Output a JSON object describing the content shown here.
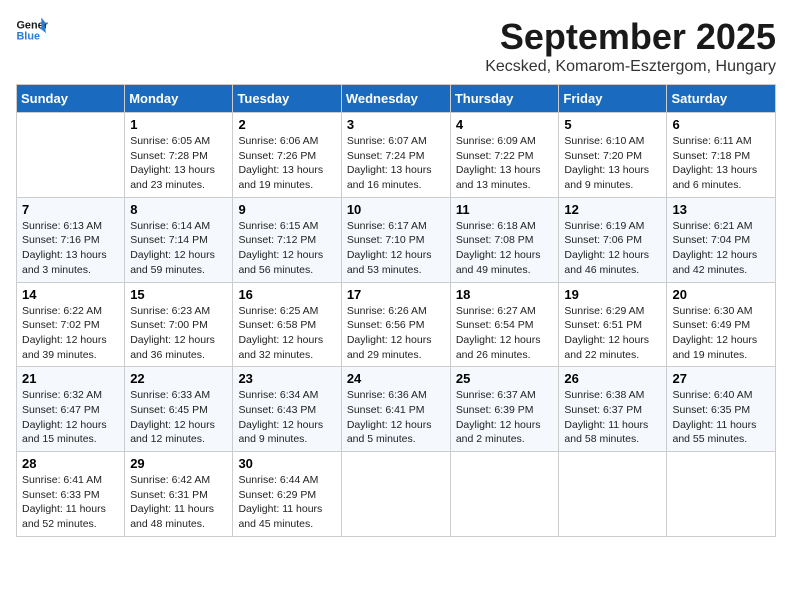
{
  "header": {
    "logo_line1": "General",
    "logo_line2": "Blue",
    "month": "September 2025",
    "location": "Kecsked, Komarom-Esztergom, Hungary"
  },
  "weekdays": [
    "Sunday",
    "Monday",
    "Tuesday",
    "Wednesday",
    "Thursday",
    "Friday",
    "Saturday"
  ],
  "weeks": [
    [
      {
        "day": "",
        "info": ""
      },
      {
        "day": "1",
        "info": "Sunrise: 6:05 AM\nSunset: 7:28 PM\nDaylight: 13 hours\nand 23 minutes."
      },
      {
        "day": "2",
        "info": "Sunrise: 6:06 AM\nSunset: 7:26 PM\nDaylight: 13 hours\nand 19 minutes."
      },
      {
        "day": "3",
        "info": "Sunrise: 6:07 AM\nSunset: 7:24 PM\nDaylight: 13 hours\nand 16 minutes."
      },
      {
        "day": "4",
        "info": "Sunrise: 6:09 AM\nSunset: 7:22 PM\nDaylight: 13 hours\nand 13 minutes."
      },
      {
        "day": "5",
        "info": "Sunrise: 6:10 AM\nSunset: 7:20 PM\nDaylight: 13 hours\nand 9 minutes."
      },
      {
        "day": "6",
        "info": "Sunrise: 6:11 AM\nSunset: 7:18 PM\nDaylight: 13 hours\nand 6 minutes."
      }
    ],
    [
      {
        "day": "7",
        "info": "Sunrise: 6:13 AM\nSunset: 7:16 PM\nDaylight: 13 hours\nand 3 minutes."
      },
      {
        "day": "8",
        "info": "Sunrise: 6:14 AM\nSunset: 7:14 PM\nDaylight: 12 hours\nand 59 minutes."
      },
      {
        "day": "9",
        "info": "Sunrise: 6:15 AM\nSunset: 7:12 PM\nDaylight: 12 hours\nand 56 minutes."
      },
      {
        "day": "10",
        "info": "Sunrise: 6:17 AM\nSunset: 7:10 PM\nDaylight: 12 hours\nand 53 minutes."
      },
      {
        "day": "11",
        "info": "Sunrise: 6:18 AM\nSunset: 7:08 PM\nDaylight: 12 hours\nand 49 minutes."
      },
      {
        "day": "12",
        "info": "Sunrise: 6:19 AM\nSunset: 7:06 PM\nDaylight: 12 hours\nand 46 minutes."
      },
      {
        "day": "13",
        "info": "Sunrise: 6:21 AM\nSunset: 7:04 PM\nDaylight: 12 hours\nand 42 minutes."
      }
    ],
    [
      {
        "day": "14",
        "info": "Sunrise: 6:22 AM\nSunset: 7:02 PM\nDaylight: 12 hours\nand 39 minutes."
      },
      {
        "day": "15",
        "info": "Sunrise: 6:23 AM\nSunset: 7:00 PM\nDaylight: 12 hours\nand 36 minutes."
      },
      {
        "day": "16",
        "info": "Sunrise: 6:25 AM\nSunset: 6:58 PM\nDaylight: 12 hours\nand 32 minutes."
      },
      {
        "day": "17",
        "info": "Sunrise: 6:26 AM\nSunset: 6:56 PM\nDaylight: 12 hours\nand 29 minutes."
      },
      {
        "day": "18",
        "info": "Sunrise: 6:27 AM\nSunset: 6:54 PM\nDaylight: 12 hours\nand 26 minutes."
      },
      {
        "day": "19",
        "info": "Sunrise: 6:29 AM\nSunset: 6:51 PM\nDaylight: 12 hours\nand 22 minutes."
      },
      {
        "day": "20",
        "info": "Sunrise: 6:30 AM\nSunset: 6:49 PM\nDaylight: 12 hours\nand 19 minutes."
      }
    ],
    [
      {
        "day": "21",
        "info": "Sunrise: 6:32 AM\nSunset: 6:47 PM\nDaylight: 12 hours\nand 15 minutes."
      },
      {
        "day": "22",
        "info": "Sunrise: 6:33 AM\nSunset: 6:45 PM\nDaylight: 12 hours\nand 12 minutes."
      },
      {
        "day": "23",
        "info": "Sunrise: 6:34 AM\nSunset: 6:43 PM\nDaylight: 12 hours\nand 9 minutes."
      },
      {
        "day": "24",
        "info": "Sunrise: 6:36 AM\nSunset: 6:41 PM\nDaylight: 12 hours\nand 5 minutes."
      },
      {
        "day": "25",
        "info": "Sunrise: 6:37 AM\nSunset: 6:39 PM\nDaylight: 12 hours\nand 2 minutes."
      },
      {
        "day": "26",
        "info": "Sunrise: 6:38 AM\nSunset: 6:37 PM\nDaylight: 11 hours\nand 58 minutes."
      },
      {
        "day": "27",
        "info": "Sunrise: 6:40 AM\nSunset: 6:35 PM\nDaylight: 11 hours\nand 55 minutes."
      }
    ],
    [
      {
        "day": "28",
        "info": "Sunrise: 6:41 AM\nSunset: 6:33 PM\nDaylight: 11 hours\nand 52 minutes."
      },
      {
        "day": "29",
        "info": "Sunrise: 6:42 AM\nSunset: 6:31 PM\nDaylight: 11 hours\nand 48 minutes."
      },
      {
        "day": "30",
        "info": "Sunrise: 6:44 AM\nSunset: 6:29 PM\nDaylight: 11 hours\nand 45 minutes."
      },
      {
        "day": "",
        "info": ""
      },
      {
        "day": "",
        "info": ""
      },
      {
        "day": "",
        "info": ""
      },
      {
        "day": "",
        "info": ""
      }
    ]
  ]
}
